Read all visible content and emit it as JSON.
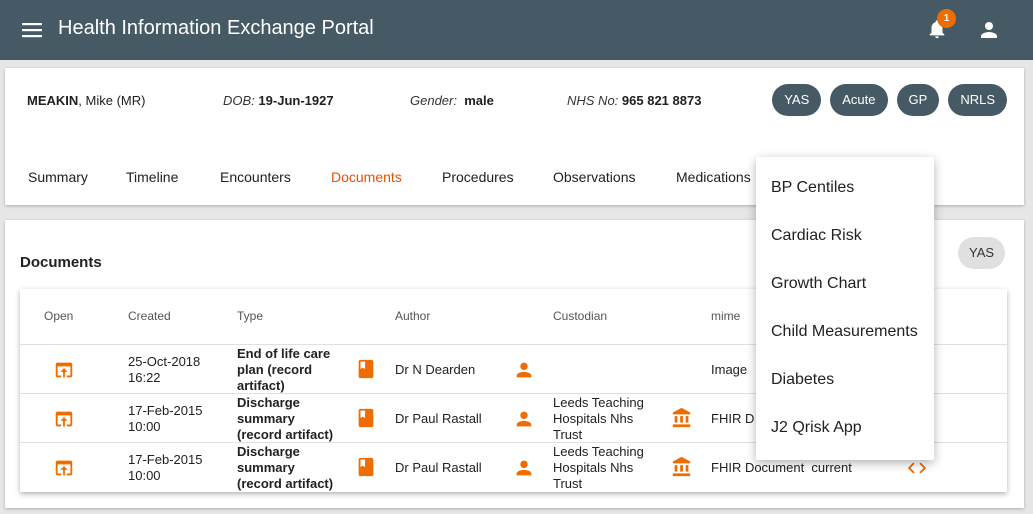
{
  "app": {
    "title": "Health Information Exchange Portal",
    "notification_count": "1"
  },
  "patient": {
    "surname": "MEAKIN",
    "given": ", Mike (MR)",
    "dob_label": "DOB:",
    "dob": "19-Jun-1927",
    "gender_label": "Gender:",
    "gender": "male",
    "nhs_label": "NHS No:",
    "nhs": "965 821 8873",
    "chips": [
      "YAS",
      "Acute",
      "GP",
      "NRLS"
    ]
  },
  "tabs": [
    "Summary",
    "Timeline",
    "Encounters",
    "Documents",
    "Procedures",
    "Observations",
    "Medications"
  ],
  "active_tab": "Documents",
  "documents": {
    "title": "Documents",
    "source_chip": "YAS",
    "headers": [
      "Open",
      "Created",
      "Type",
      "Author",
      "Custodian",
      "mime"
    ],
    "rows": [
      {
        "created": [
          "25-Oct-2018",
          "16:22"
        ],
        "type": [
          "End of life care",
          "plan (record",
          "artifact)"
        ],
        "author": "Dr N Dearden",
        "custodian": [],
        "mime": "Image"
      },
      {
        "created": [
          "17-Feb-2015",
          "10:00"
        ],
        "type": [
          "Discharge",
          "summary",
          "(record artifact)"
        ],
        "author": "Dr Paul Rastall",
        "custodian": [
          "Leeds Teaching",
          "Hospitals Nhs",
          "Trust"
        ],
        "mime": "FHIR D"
      },
      {
        "created": [
          "17-Feb-2015",
          "10:00"
        ],
        "type": [
          "Discharge",
          "summary",
          "(record artifact)"
        ],
        "author": "Dr Paul Rastall",
        "custodian": [
          "Leeds Teaching",
          "Hospitals Nhs",
          "Trust"
        ],
        "mime": "FHIR Document  current"
      }
    ]
  },
  "apps_menu": [
    "BP Centiles",
    "Cardiac Risk",
    "Growth Chart",
    "Child Measurements",
    "Diabetes",
    "J2 Qrisk App"
  ],
  "colors": {
    "appbar": "#455a64",
    "accent": "#e65100",
    "icon_orange": "#ef6c00"
  },
  "icons": {
    "menu": "hamburger-icon",
    "bell": "bell-icon",
    "account": "account-icon",
    "open": "open-in-browser-icon",
    "book": "book-icon",
    "person": "person-icon",
    "bank": "bank-icon",
    "code": "code-icon"
  }
}
